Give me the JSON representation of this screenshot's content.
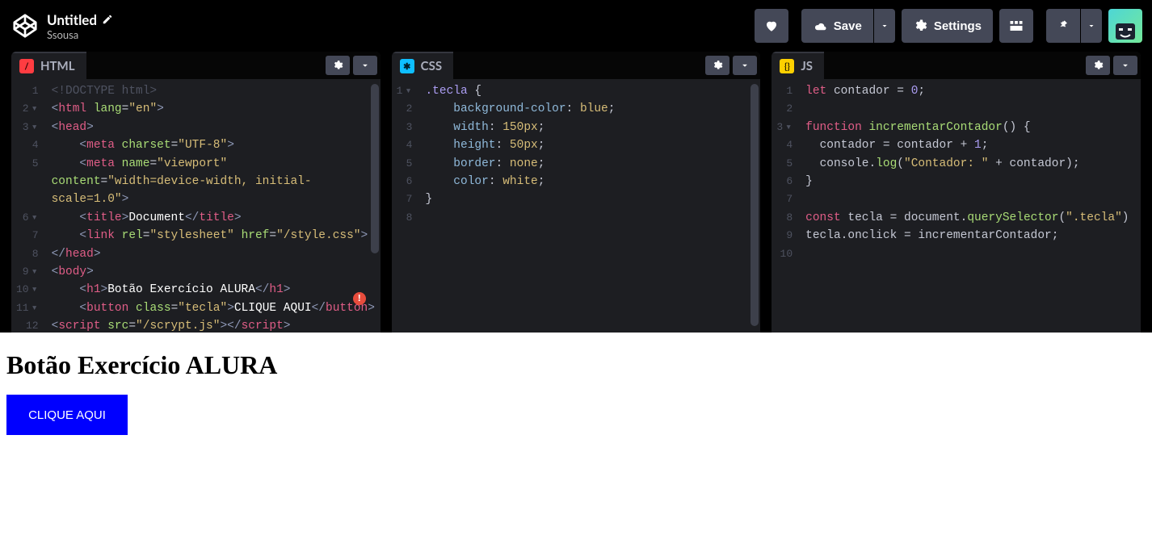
{
  "header": {
    "title": "Untitled",
    "author": "Ssousa",
    "save_label": "Save",
    "settings_label": "Settings"
  },
  "panels": {
    "html": {
      "label": "HTML"
    },
    "css": {
      "label": "CSS"
    },
    "js": {
      "label": "JS"
    }
  },
  "gutters": {
    "html": "1\n2\n3\n4\n5\n\n\n6\n7\n8\n9\n10\n11\n12",
    "css": "1\n2\n3\n4\n5\n6\n7\n8",
    "js": "1\n2\n3\n4\n5\n6\n7\n8\n9\n10"
  },
  "html_code": {
    "l1_doctype": "<!DOCTYPE html>",
    "l6_title_text": "Document",
    "l10_h1_text": "Botão Exercício ALURA",
    "l11_btn_text": "CLIQUE AQUI",
    "attr_lang": "\"en\"",
    "attr_charset": "\"UTF-8\"",
    "attr_name": "\"viewport\"",
    "attr_content": "\"width=device-width, initial-scale=1.0\"",
    "attr_rel": "\"stylesheet\"",
    "attr_href": "\"/style.css\"",
    "attr_class": "\"tecla\"",
    "attr_src": "\"/scrypt.js\""
  },
  "css_code": {
    "selector": ".tecla",
    "bg": "background-color",
    "bg_val": "blue",
    "width": "width",
    "width_val": "150px",
    "height": "height",
    "height_val": "50px",
    "border": "border",
    "border_val": "none",
    "color": "color",
    "color_val": "white"
  },
  "js_code": {
    "let": "let",
    "contador": "contador",
    "zero": "0",
    "function": "function",
    "fn_name": "incrementarContador",
    "plus1": "1",
    "console": "console",
    "log": "log",
    "log_str": "\"Contador: \"",
    "const": "const",
    "tecla": "tecla",
    "document": "document",
    "qsel": "querySelector",
    "qsel_arg": "\".tecla\"",
    "onclick": "onclick"
  },
  "preview": {
    "heading": "Botão Exercício ALURA",
    "button": "CLIQUE AQUI"
  }
}
